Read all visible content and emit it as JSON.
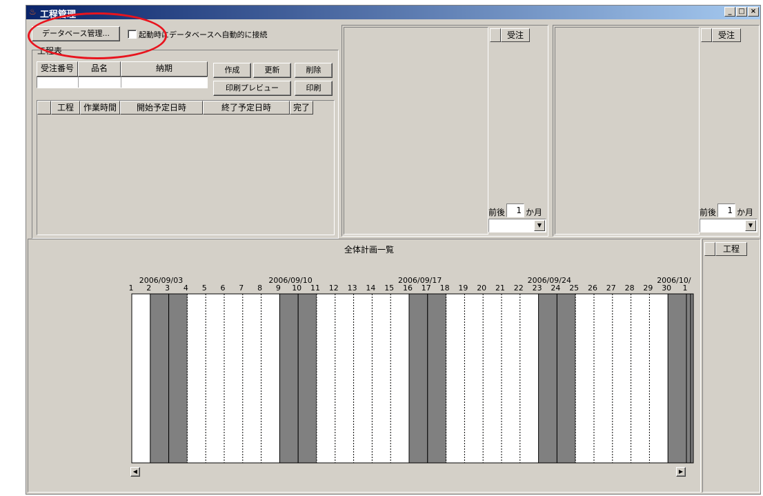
{
  "window": {
    "title": "工程管理",
    "controls": [
      "_",
      "□",
      "×"
    ]
  },
  "toolbar": {
    "db_manage_label": "データベース管理...",
    "auto_connect_label": "起動時にデータベースへ自動的に接続",
    "auto_connect_checked": false
  },
  "process_table": {
    "group_label": "工程表",
    "order_headers": [
      "受注番号",
      "品名",
      "納期"
    ],
    "buttons": {
      "create": "作成",
      "update": "更新",
      "delete": "削除",
      "print_preview": "印刷プレビュー",
      "print": "印刷"
    },
    "process_headers": [
      "",
      "工程",
      "作業時間",
      "開始予定日時",
      "終了予定日時",
      "完了"
    ]
  },
  "order_panels": [
    {
      "header": "受注",
      "range_prefix": "前後",
      "range_value": "1",
      "range_suffix": "か月"
    },
    {
      "header": "受注",
      "range_prefix": "前後",
      "range_value": "1",
      "range_suffix": "か月"
    }
  ],
  "overview": {
    "title": "全体計画一覧",
    "side_header": "工程"
  },
  "chart_data": {
    "type": "table",
    "date_labels": [
      {
        "text": "2006/09/03",
        "day_index": 1
      },
      {
        "text": "2006/09/10",
        "day_index": 8
      },
      {
        "text": "2006/09/17",
        "day_index": 15
      },
      {
        "text": "2006/09/24",
        "day_index": 22
      },
      {
        "text": "2006/10/",
        "day_index": 29
      }
    ],
    "days": [
      "1",
      "2",
      "3",
      "4",
      "5",
      "6",
      "7",
      "8",
      "9",
      "10",
      "11",
      "12",
      "13",
      "14",
      "15",
      "16",
      "17",
      "18",
      "19",
      "20",
      "21",
      "22",
      "23",
      "24",
      "25",
      "26",
      "27",
      "28",
      "29",
      "30",
      "1"
    ],
    "weekend_day_indices": [
      1,
      2,
      8,
      9,
      15,
      16,
      22,
      23,
      29,
      30
    ],
    "colors": {
      "weekend": "#808080",
      "weekday": "#ffffff"
    }
  }
}
